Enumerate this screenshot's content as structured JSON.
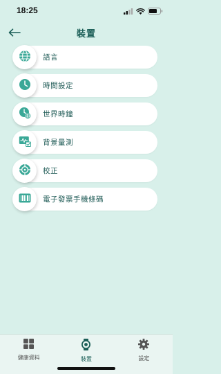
{
  "status_bar": {
    "time": "18:25"
  },
  "header": {
    "title": "裝置"
  },
  "menu": [
    {
      "label": "語言",
      "icon": "globe-icon"
    },
    {
      "label": "時間設定",
      "icon": "clock-icon"
    },
    {
      "label": "世界時鐘",
      "icon": "world-clock-icon"
    },
    {
      "label": "背景量測",
      "icon": "background-measure-icon"
    },
    {
      "label": "校正",
      "icon": "calibrate-target-icon"
    },
    {
      "label": "電子發票手機條碼",
      "icon": "barcode-icon"
    }
  ],
  "tabbar": {
    "tabs": [
      {
        "label": "健康資料",
        "icon": "grid-icon",
        "active": false
      },
      {
        "label": "裝置",
        "icon": "watch-icon",
        "active": true
      },
      {
        "label": "設定",
        "icon": "gear-icon",
        "active": false
      }
    ]
  },
  "colors": {
    "background": "#d8f0ea",
    "accent": "#3aa897",
    "title": "#1b5e57"
  }
}
